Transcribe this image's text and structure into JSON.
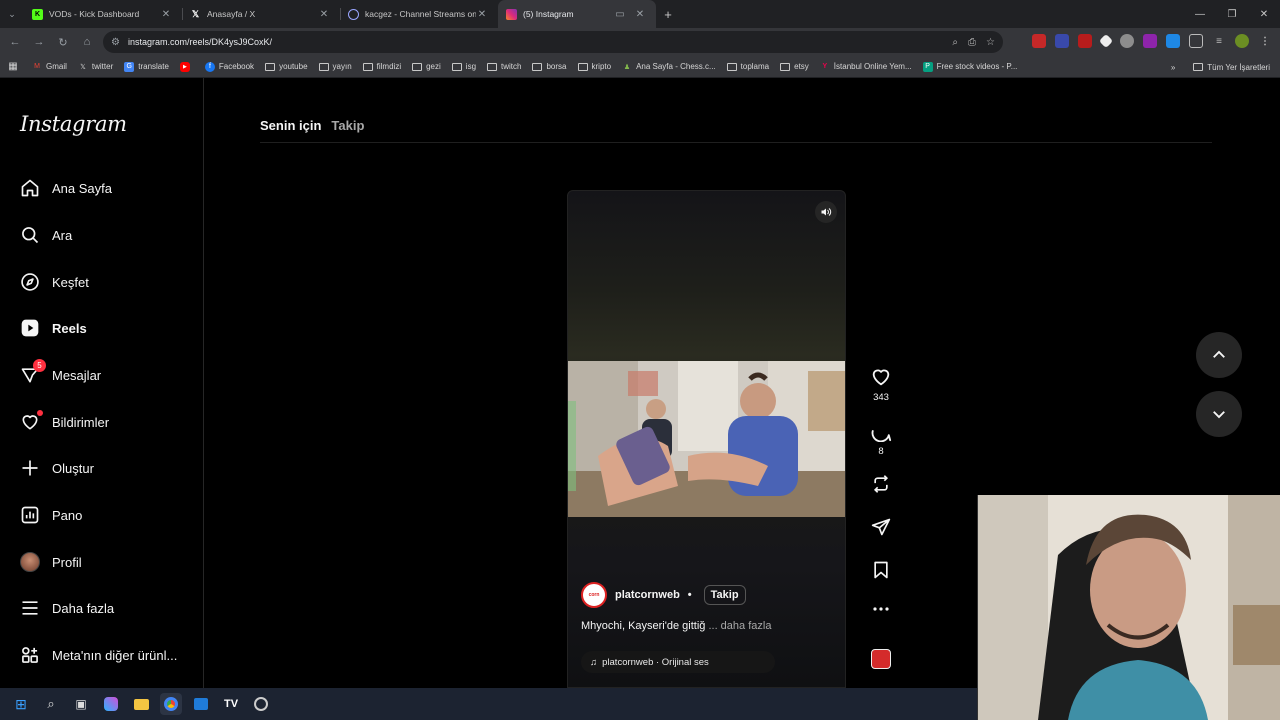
{
  "browser": {
    "tabs": [
      {
        "title": "VODs - Kick Dashboard",
        "favicon": "kick-icon",
        "color": "#53fc18"
      },
      {
        "title": "Anasayfa / X",
        "favicon": "x-icon",
        "color": "#ffffff"
      },
      {
        "title": "kacgez - Channel Streams on Kick",
        "favicon": "streams-icon",
        "color": "#9aa6ff"
      },
      {
        "title": "(5) Instagram",
        "favicon": "instagram-icon",
        "color": "#e1306c"
      }
    ],
    "url": "instagram.com/reels/DK4ysJ9CoxK/",
    "bookmarks": [
      {
        "label": "Gmail",
        "icon": "gmail-icon"
      },
      {
        "label": "twitter",
        "icon": "x-icon"
      },
      {
        "label": "translate",
        "icon": "translate-icon"
      },
      {
        "label": "",
        "icon": "youtube-icon"
      },
      {
        "label": "Facebook",
        "icon": "facebook-icon"
      },
      {
        "label": "youtube",
        "icon": "folder-icon"
      },
      {
        "label": "yayın",
        "icon": "folder-icon"
      },
      {
        "label": "filmdizi",
        "icon": "folder-icon"
      },
      {
        "label": "gezi",
        "icon": "folder-icon"
      },
      {
        "label": "isg",
        "icon": "folder-icon"
      },
      {
        "label": "twitch",
        "icon": "folder-icon"
      },
      {
        "label": "borsa",
        "icon": "folder-icon"
      },
      {
        "label": "kripto",
        "icon": "folder-icon"
      },
      {
        "label": "Ana Sayfa - Chess.c...",
        "icon": "chess-icon"
      },
      {
        "label": "toplama",
        "icon": "folder-icon"
      },
      {
        "label": "etsy",
        "icon": "folder-icon"
      },
      {
        "label": "İstanbul Online Yem...",
        "icon": "yemek-icon"
      },
      {
        "label": "Free stock videos - P...",
        "icon": "pexels-icon"
      }
    ],
    "all_bookmarks": "Tüm Yer İşaretleri"
  },
  "instagram": {
    "logo": "Instagram",
    "nav": [
      {
        "label": "Ana Sayfa",
        "icon": "home-icon"
      },
      {
        "label": "Ara",
        "icon": "search-icon"
      },
      {
        "label": "Keşfet",
        "icon": "compass-icon"
      },
      {
        "label": "Reels",
        "icon": "reels-icon"
      },
      {
        "label": "Mesajlar",
        "icon": "messenger-icon",
        "badge": "5"
      },
      {
        "label": "Bildirimler",
        "icon": "heart-icon"
      },
      {
        "label": "Oluştur",
        "icon": "plus-icon"
      },
      {
        "label": "Pano",
        "icon": "dashboard-icon"
      },
      {
        "label": "Profil",
        "icon": "profile-avatar"
      },
      {
        "label": "Daha fazla",
        "icon": "menu-icon"
      },
      {
        "label": "Meta'nın diğer ürünl...",
        "icon": "meta-apps-icon"
      }
    ],
    "feed_tabs": [
      "Senin için",
      "Takip"
    ],
    "reel": {
      "author": "platcornweb",
      "separator": "•",
      "follow": "Takip",
      "caption": "Mhyochi, Kayseri'de gittiğ",
      "caption_more": "... daha fazla",
      "audio": "platcornweb · Orijinal ses",
      "likes": "343",
      "comments": "8"
    }
  }
}
